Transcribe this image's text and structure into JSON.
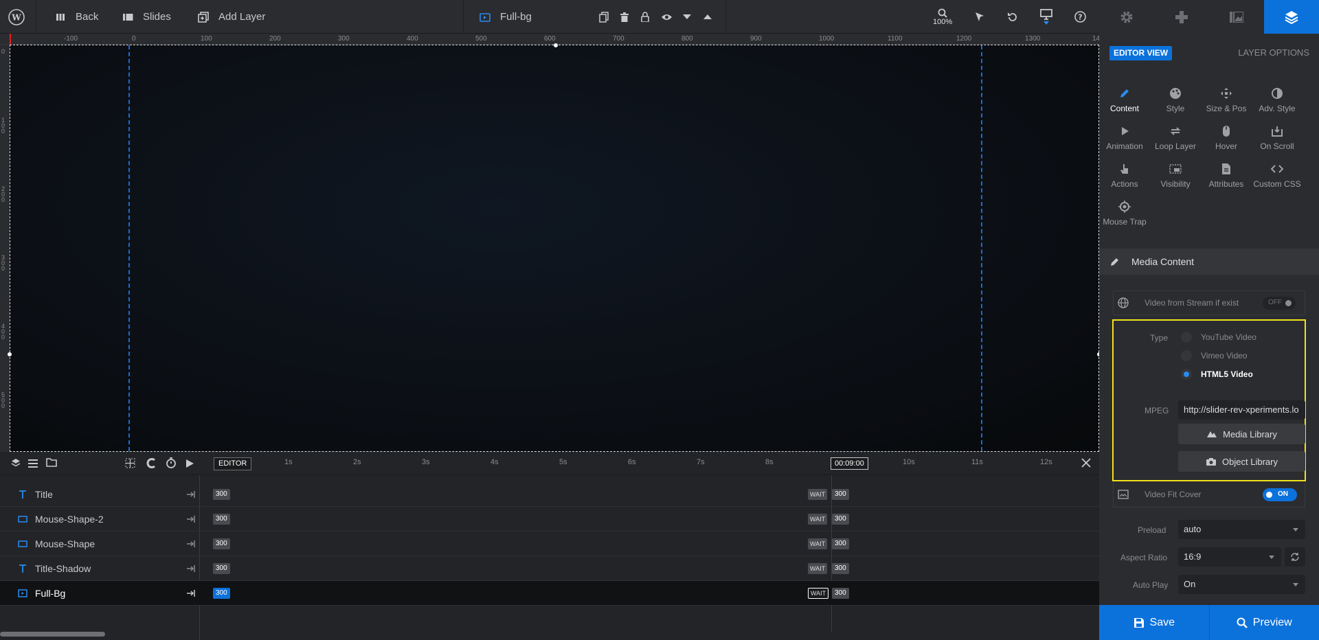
{
  "topbar": {
    "back_label": "Back",
    "slides_label": "Slides",
    "add_layer_label": "Add Layer",
    "layer_name": "Full-bg",
    "zoom_label": "100%"
  },
  "ruler": {
    "h_ticks": [
      "-100",
      "0",
      "100",
      "200",
      "300",
      "400",
      "500",
      "600",
      "700",
      "800",
      "900",
      "1000",
      "1100",
      "1200",
      "1300",
      "14"
    ],
    "v_ticks": [
      "0",
      "100",
      "200",
      "300",
      "400",
      "500"
    ]
  },
  "timeline": {
    "editor_label": "EDITOR",
    "time_marks": [
      "1s",
      "2s",
      "3s",
      "4s",
      "5s",
      "6s",
      "7s",
      "8s",
      "10s",
      "11s",
      "12s"
    ],
    "current_time": "00:09:00",
    "layers": [
      {
        "name": "Title",
        "type": "text",
        "start": "300",
        "wait": "WAIT",
        "end": "300"
      },
      {
        "name": "Mouse-Shape-2",
        "type": "shape",
        "start": "300",
        "wait": "WAIT",
        "end": "300"
      },
      {
        "name": "Mouse-Shape",
        "type": "shape",
        "start": "300",
        "wait": "WAIT",
        "end": "300"
      },
      {
        "name": "Title-Shadow",
        "type": "text",
        "start": "300",
        "wait": "WAIT",
        "end": "300"
      },
      {
        "name": "Full-Bg",
        "type": "video",
        "start": "300",
        "wait": "WAIT",
        "end": "300"
      }
    ]
  },
  "panel": {
    "editor_view": "EDITOR VIEW",
    "layer_options": "LAYER OPTIONS",
    "tabs": [
      {
        "label": "Content"
      },
      {
        "label": "Style"
      },
      {
        "label": "Size & Pos"
      },
      {
        "label": "Adv. Style"
      },
      {
        "label": "Animation"
      },
      {
        "label": "Loop Layer"
      },
      {
        "label": "Hover"
      },
      {
        "label": "On Scroll"
      },
      {
        "label": "Actions"
      },
      {
        "label": "Visibility"
      },
      {
        "label": "Attributes"
      },
      {
        "label": "Custom CSS"
      },
      {
        "label": "Mouse Trap"
      }
    ],
    "section_title": "Media Content",
    "stream_label": "Video from Stream if exist",
    "stream_toggle": "OFF",
    "type_label": "Type",
    "type_options": [
      "YouTube Video",
      "Vimeo Video",
      "HTML5 Video"
    ],
    "mpeg_label": "MPEG",
    "mpeg_value": "http://slider-rev-xperiments.lo",
    "media_library": "Media Library",
    "object_library": "Object Library",
    "fit_cover_label": "Video Fit Cover",
    "fit_cover_toggle": "ON",
    "preload_label": "Preload",
    "preload_value": "auto",
    "aspect_label": "Aspect Ratio",
    "aspect_value": "16:9",
    "autoplay_label": "Auto Play",
    "autoplay_value": "On",
    "save_label": "Save",
    "preview_label": "Preview"
  },
  "colors": {
    "accent": "#0c72db",
    "highlight": "#f2e21b"
  }
}
